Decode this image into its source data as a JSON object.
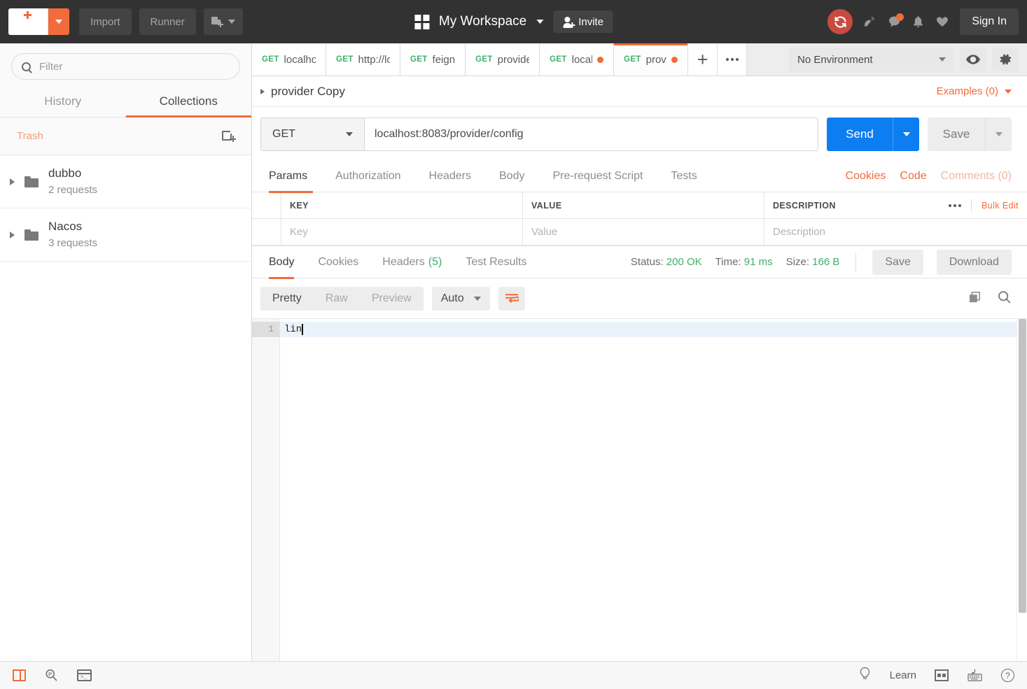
{
  "header": {
    "new_button": "New",
    "import_button": "Import",
    "runner_button": "Runner",
    "workspace_title": "My Workspace",
    "invite_button": "Invite",
    "signin_button": "Sign In",
    "icons": {
      "new_plus": "plus-icon",
      "new_window": "new-window-icon",
      "workspace_grid": "grid-icon",
      "invite_person": "person-add-icon",
      "sync": "sync-icon",
      "satellite": "satellite-icon",
      "comment": "comment-icon",
      "bell": "bell-icon",
      "heart": "heart-icon"
    },
    "accent_orange": "#f26b3a",
    "sync_red": "#c94a41"
  },
  "sidebar": {
    "filter_placeholder": "Filter",
    "tabs": [
      {
        "label": "History",
        "active": false
      },
      {
        "label": "Collections",
        "active": true
      }
    ],
    "trash_label": "Trash",
    "collections": [
      {
        "name": "dubbo",
        "requests": "2 requests"
      },
      {
        "name": "Nacos",
        "requests": "3 requests"
      }
    ]
  },
  "request_tabs": {
    "items": [
      {
        "method": "GET",
        "name": "localhost",
        "unsaved": false,
        "active": false
      },
      {
        "method": "GET",
        "name": "http://loc",
        "unsaved": false,
        "active": false
      },
      {
        "method": "GET",
        "name": "feign",
        "unsaved": false,
        "active": false
      },
      {
        "method": "GET",
        "name": "provider",
        "unsaved": false,
        "active": false
      },
      {
        "method": "GET",
        "name": "localh",
        "unsaved": true,
        "active": false
      },
      {
        "method": "GET",
        "name": "provi",
        "unsaved": true,
        "active": true
      }
    ]
  },
  "environment": {
    "selected": "No Environment",
    "eye_icon": "eye-icon",
    "gear_icon": "gear-icon"
  },
  "breadcrumb": {
    "title": "provider Copy",
    "examples": "Examples (0)"
  },
  "url_bar": {
    "method": "GET",
    "url": "localhost:8083/provider/config",
    "send_label": "Send",
    "save_label": "Save"
  },
  "request_section": {
    "tabs": [
      {
        "label": "Params",
        "active": true
      },
      {
        "label": "Authorization",
        "active": false
      },
      {
        "label": "Headers",
        "active": false
      },
      {
        "label": "Body",
        "active": false
      },
      {
        "label": "Pre-request Script",
        "active": false
      },
      {
        "label": "Tests",
        "active": false
      }
    ],
    "links": {
      "cookies": "Cookies",
      "code": "Code",
      "comments": "Comments (0)"
    },
    "params_table": {
      "headers": [
        "KEY",
        "VALUE",
        "DESCRIPTION"
      ],
      "bulk_edit": "Bulk Edit",
      "row_placeholders": [
        "Key",
        "Value",
        "Description"
      ]
    }
  },
  "response_section": {
    "tabs": [
      {
        "label": "Body",
        "count": "",
        "active": true
      },
      {
        "label": "Cookies",
        "count": "",
        "active": false
      },
      {
        "label": "Headers",
        "count": "(5)",
        "active": false
      },
      {
        "label": "Test Results",
        "count": "",
        "active": false
      }
    ],
    "meta": {
      "status_label": "Status:",
      "status_value": "200 OK",
      "time_label": "Time:",
      "time_value": "91 ms",
      "size_label": "Size:",
      "size_value": "166 B"
    },
    "save_button": "Save",
    "download_button": "Download",
    "view_modes": [
      {
        "label": "Pretty",
        "active": true
      },
      {
        "label": "Raw",
        "active": false
      },
      {
        "label": "Preview",
        "active": false
      }
    ],
    "format_selected": "Auto",
    "wrap_icon": "word-wrap-icon",
    "copy_icon": "copy-icon",
    "search_icon": "search-icon",
    "body": {
      "line_number": "1",
      "line_text": "lin"
    }
  },
  "footer": {
    "left_icons": [
      "sidebar-toggle-icon",
      "find-replace-icon",
      "console-icon"
    ],
    "learn_label": "Learn",
    "right_icons": [
      "two-pane-icon",
      "keyboard-shortcuts-icon",
      "help-icon"
    ]
  }
}
